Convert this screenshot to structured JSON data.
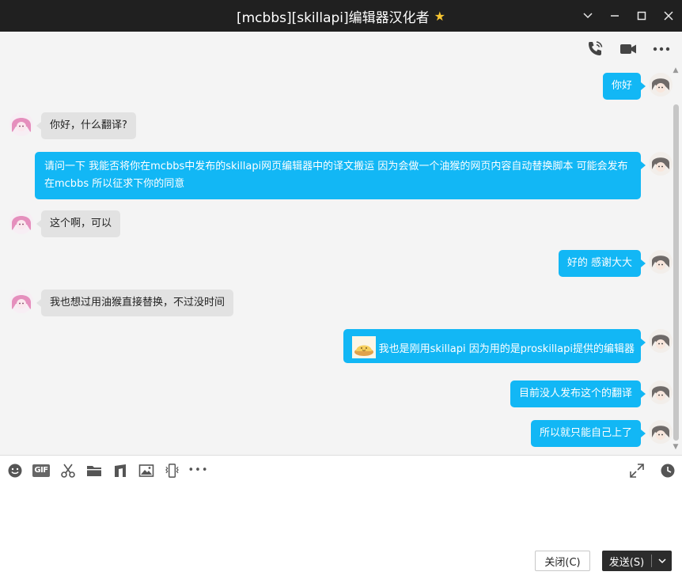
{
  "window": {
    "title": "[mcbbs][skillapi]编辑器汉化者",
    "minimize": "⌄",
    "restore": "─",
    "maximize": "☐",
    "close": "✕"
  },
  "colors": {
    "titlebar": "#202020",
    "chat_bg": "#f4f4f4",
    "outgoing_bubble": "#12b7f5",
    "incoming_bubble": "#e2e2e2",
    "star": "#f7c531"
  },
  "header_actions": [
    "phone-call-icon",
    "video-call-icon",
    "more-options-icon"
  ],
  "messages": [
    {
      "side": "out",
      "text": "你好"
    },
    {
      "side": "in",
      "text": "你好，什么翻译?"
    },
    {
      "side": "out",
      "text": "请问一下 我能否将你在mcbbs中发布的skillapi网页编辑器中的译文搬运 因为会做一个油猴的网页内容自动替换脚本 可能会发布在mcbbs 所以征求下你的同意"
    },
    {
      "side": "in",
      "text": "这个啊，可以"
    },
    {
      "side": "out",
      "text": "好的 感谢大大"
    },
    {
      "side": "in",
      "text": "我也想过用油猴直接替换，不过没时间"
    },
    {
      "side": "out",
      "text": "我也是刚用skillapi 因为用的是proskillapi提供的编辑器",
      "has_emoji": true
    },
    {
      "side": "out",
      "text": "目前没人发布这个的翻译"
    },
    {
      "side": "out",
      "text": "所以就只能自己上了"
    }
  ],
  "toolbar": {
    "gif_label": "GIF",
    "more": "•••"
  },
  "buttons": {
    "close_label": "关闭(C)",
    "send_label": "发送(S)",
    "send_dropdown": "⌄"
  }
}
